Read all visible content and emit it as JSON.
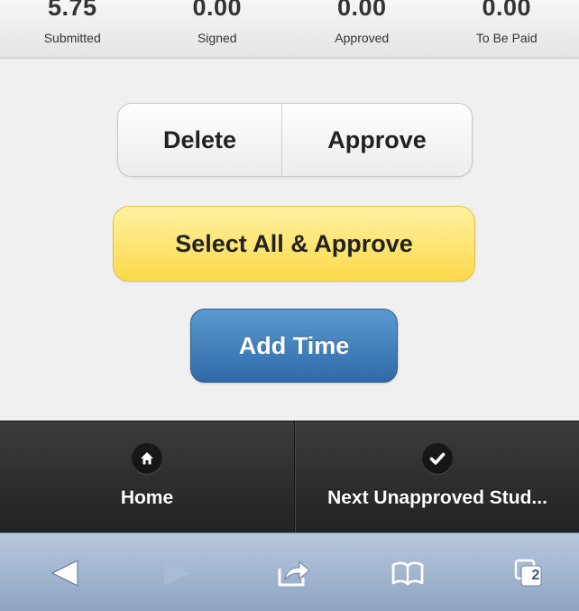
{
  "stats": [
    {
      "value": "5.75",
      "label": "Submitted"
    },
    {
      "value": "0.00",
      "label": "Signed"
    },
    {
      "value": "0.00",
      "label": "Approved"
    },
    {
      "value": "0.00",
      "label": "To Be Paid"
    }
  ],
  "actions": {
    "delete_label": "Delete",
    "approve_label": "Approve",
    "select_all_label": "Select All & Approve",
    "add_time_label": "Add Time"
  },
  "navbar": {
    "home_label": "Home",
    "next_label": "Next Unapproved Stud...",
    "home_icon": "home-icon",
    "next_icon": "check-icon"
  },
  "toolbar": {
    "back_icon": "back-arrow-icon",
    "forward_icon": "forward-arrow-icon",
    "share_icon": "share-icon",
    "bookmarks_icon": "bookmarks-icon",
    "tabs_icon": "tabs-icon",
    "tab_count": "2"
  },
  "colors": {
    "primary_blue": "#306aa6",
    "highlight_yellow": "#fcd94a",
    "navbar_dark": "#2a2a2a",
    "toolbar_blue": "#8da4c2"
  }
}
